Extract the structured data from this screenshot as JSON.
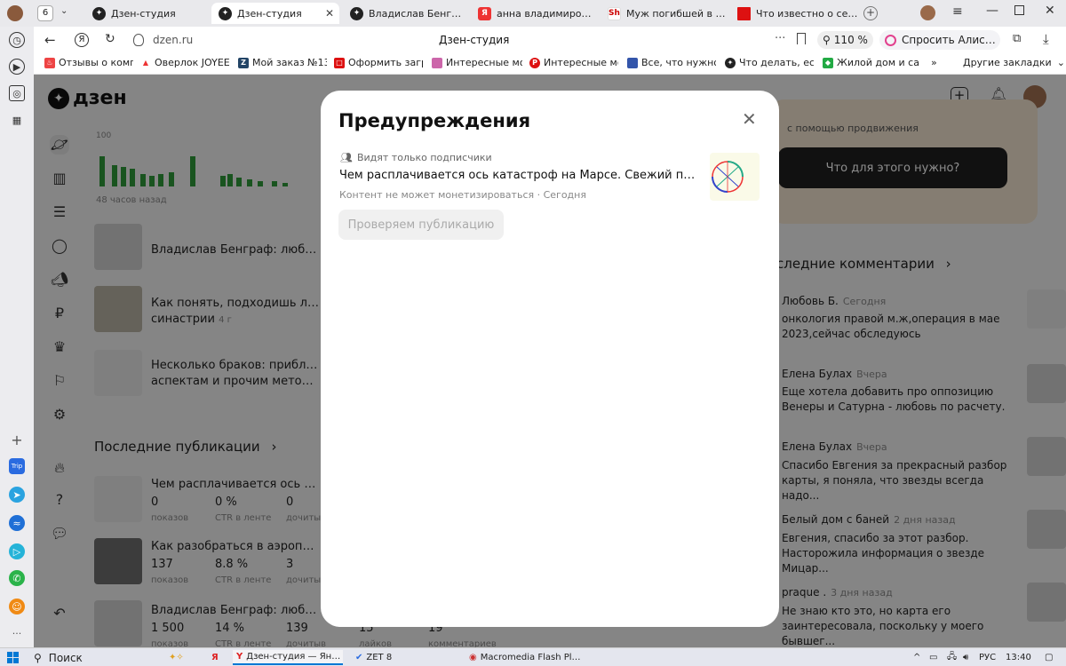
{
  "browser": {
    "tab_count": "6",
    "tabs": [
      {
        "title": "Дзен-студия"
      },
      {
        "title": "Дзен-студия"
      },
      {
        "title": "Владислав Бенграф: лю"
      },
      {
        "title": "анна владимирова дтп"
      },
      {
        "title": "Муж погибшей в ДТП с"
      },
      {
        "title": "Что известно о семье в"
      }
    ],
    "url": "dzen.ru",
    "page_title": "Дзен-студия",
    "zoom": "110 %",
    "alice_label": "Спросить Алису AI",
    "bookmarks": [
      "Отзывы о компан",
      "Оверлок JOYEE Л",
      "Мой заказ №137",
      "Оформить загран",
      "Интересные моде",
      "Интересные моде",
      "Все, что нужно зн",
      "Что делать, если",
      "Жилой дом и са"
    ],
    "other_bookmarks": "Другие закладки"
  },
  "dzen": {
    "logo": "дзен",
    "chart": {
      "ymax_label": "100",
      "caption": "48 часов назад"
    },
    "posts": [
      {
        "title": "Владислав Бенграф: любовь-м",
        "sub": ""
      },
      {
        "title": "Как понять, подходишь ли ты в",
        "sub": "синастрии",
        "age": "4 г"
      },
      {
        "title": "Несколько браков: приблизите",
        "sub": "аспектам и прочим методикам"
      }
    ],
    "latest_publications": "Последние публикации",
    "publications": [
      {
        "title": "Чем расплачивается ось катаст",
        "views": "0",
        "ctr": "0 %",
        "reads": "0"
      },
      {
        "title": "Как разобраться в аэропорту, ",
        "views": "137",
        "ctr": "8.8 %",
        "reads": "3"
      },
      {
        "title": "Владислав Бенграф: любовь-м",
        "views": "1 500",
        "ctr": "14 %",
        "reads": "139",
        "likes": "15",
        "comments": "19"
      }
    ],
    "stat_labels": {
      "views": "показов",
      "ctr": "CTR в ленте",
      "reads": "дочитыв",
      "likes": "лайков",
      "comments": "комментариев"
    },
    "promo_text": "с помощью продвижения",
    "promo_button": "Что для этого нужно?",
    "comments_header": "следние комментарии",
    "comments": [
      {
        "name": "Любовь Б.",
        "when": "Сегодня",
        "text": "онкология правой м.ж,операция в мае 2023,сейчас обследуюсь"
      },
      {
        "name": "Елена Булах",
        "when": "Вчера",
        "text": "Еще хотела добавить про оппозицию Венеры и Сатурна - любовь по расчету."
      },
      {
        "name": "Елена Булах",
        "when": "Вчера",
        "text": "Спасибо Евгения за прекрасный разбор карты, я поняла, что звезды всегда надо..."
      },
      {
        "name": "Белый дом с баней",
        "when": "2 дня назад",
        "text": "Евгения, спасибо за этот разбор. Насторожила информация о звезде Мицар..."
      },
      {
        "name": "praque .",
        "when": "3 дня назад",
        "text": "Не знаю кто это, но карта его заинтересовала, поскольку у моего бывшег..."
      }
    ]
  },
  "modal": {
    "title": "Предупреждения",
    "audience": "Видят только подписчики",
    "article_title": "Чем расплачивается ось катастроф на Марсе. Свежий пример",
    "meta": "Контент не может монетизироваться · Сегодня",
    "check_button": "Проверяем публикацию"
  },
  "taskbar": {
    "search": "Поиск",
    "apps": [
      "Дзен-студия — Янде...",
      "ZET 8",
      "Macromedia Flash Pla..."
    ],
    "lang": "РУС",
    "time": "13:40"
  },
  "colors": {
    "accent": "#2e9a3a",
    "dim": "rgba(0,0,0,0.45)",
    "alice": "#e2418e"
  }
}
